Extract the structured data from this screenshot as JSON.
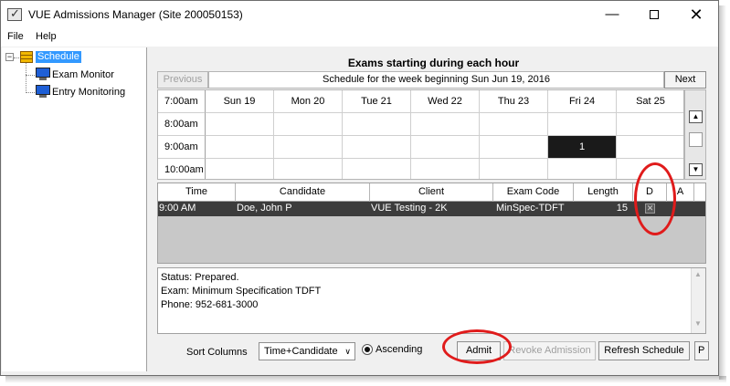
{
  "window": {
    "title": "VUE Admissions Manager (Site 200050153)"
  },
  "menu": {
    "items": [
      "File",
      "Help"
    ]
  },
  "tree": {
    "root": "Schedule",
    "children": [
      "Exam Monitor",
      "Entry Monitoring"
    ]
  },
  "schedule": {
    "heading": "Exams starting during each hour",
    "prev_label": "Previous",
    "next_label": "Next",
    "week_label": "Schedule for the week beginning Sun Jun 19, 2016",
    "days": [
      "Sun 19",
      "Mon 20",
      "Tue 21",
      "Wed 22",
      "Thu 23",
      "Fri 24",
      "Sat 25"
    ],
    "hours": [
      "7:00am",
      "8:00am",
      "9:00am",
      "10:00am"
    ],
    "highlight_cell": {
      "hour": "9:00am",
      "day": "Fri 24",
      "count": "1"
    }
  },
  "exams_table": {
    "columns": [
      "Time",
      "Candidate",
      "Client",
      "Exam Code",
      "Length",
      "D",
      "A"
    ],
    "rows": [
      {
        "time": "9:00 AM",
        "candidate": "Doe, John P",
        "client": "VUE Testing - 2K",
        "exam_code": "MinSpec-TDFT",
        "length": "15",
        "d_checked": false
      }
    ]
  },
  "status": {
    "lines": [
      "Status: Prepared.",
      "Exam: Minimum Specification TDFT",
      "Phone: 952-681-3000"
    ]
  },
  "bottom": {
    "sort_label": "Sort Columns",
    "sort_value": "Time+Candidate",
    "ascending_label": "Ascending",
    "admit_label": "Admit",
    "revoke_label": "Revoke Admission",
    "refresh_label": "Refresh Schedule",
    "extra_label": "P"
  },
  "colors": {
    "annotation_ring": "#e01b1b",
    "selection": "#3399ff",
    "row_selected": "#3c3c3c"
  }
}
